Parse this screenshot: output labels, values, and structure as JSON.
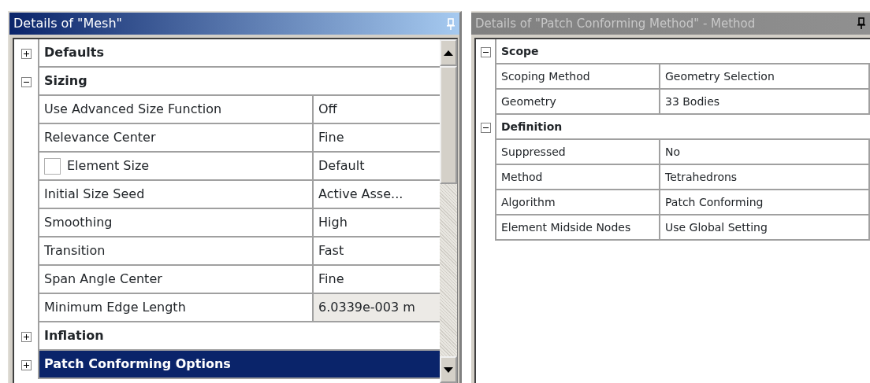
{
  "panels": [
    {
      "title": "Details of \"Mesh\"",
      "active": true,
      "scrollable": true,
      "groups": [
        {
          "label": "Defaults",
          "expanded": false,
          "selected": false
        },
        {
          "label": "Sizing",
          "expanded": true,
          "selected": false,
          "rows": [
            {
              "kind": "text",
              "label": "Use Advanced Size Function",
              "value": "Off",
              "readonly": false
            },
            {
              "kind": "text",
              "label": "Relevance Center",
              "value": "Fine",
              "readonly": false
            },
            {
              "kind": "checkbox",
              "label": "Element Size",
              "value": "Default",
              "checked": false,
              "readonly": false
            },
            {
              "kind": "text",
              "label": "Initial Size Seed",
              "value": "Active Asse...",
              "readonly": false
            },
            {
              "kind": "text",
              "label": "Smoothing",
              "value": "High",
              "readonly": false
            },
            {
              "kind": "text",
              "label": "Transition",
              "value": "Fast",
              "readonly": false
            },
            {
              "kind": "text",
              "label": "Span Angle Center",
              "value": "Fine",
              "readonly": false
            },
            {
              "kind": "text",
              "label": "Minimum Edge Length",
              "value": "6.0339e-003 m",
              "readonly": true
            }
          ]
        },
        {
          "label": "Inflation",
          "expanded": false,
          "selected": false
        },
        {
          "label": "Patch Conforming Options",
          "expanded": false,
          "selected": true
        }
      ]
    },
    {
      "title": "Details of \"Patch Conforming Method\" - Method",
      "active": false,
      "groups": [
        {
          "label": "Scope",
          "expanded": true,
          "selected": false,
          "rows": [
            {
              "kind": "text",
              "label": "Scoping Method",
              "value": "Geometry Selection",
              "readonly": false
            },
            {
              "kind": "text",
              "label": "Geometry",
              "value": "33 Bodies",
              "readonly": false
            }
          ]
        },
        {
          "label": "Definition",
          "expanded": true,
          "selected": false,
          "rows": [
            {
              "kind": "text",
              "label": "Suppressed",
              "value": "No",
              "readonly": false
            },
            {
              "kind": "text",
              "label": "Method",
              "value": "Tetrahedrons",
              "readonly": false
            },
            {
              "kind": "text",
              "label": "Algorithm",
              "value": "Patch Conforming",
              "readonly": false
            },
            {
              "kind": "text",
              "label": "Element Midside Nodes",
              "value": "Use Global Setting",
              "readonly": false
            }
          ]
        }
      ]
    }
  ]
}
